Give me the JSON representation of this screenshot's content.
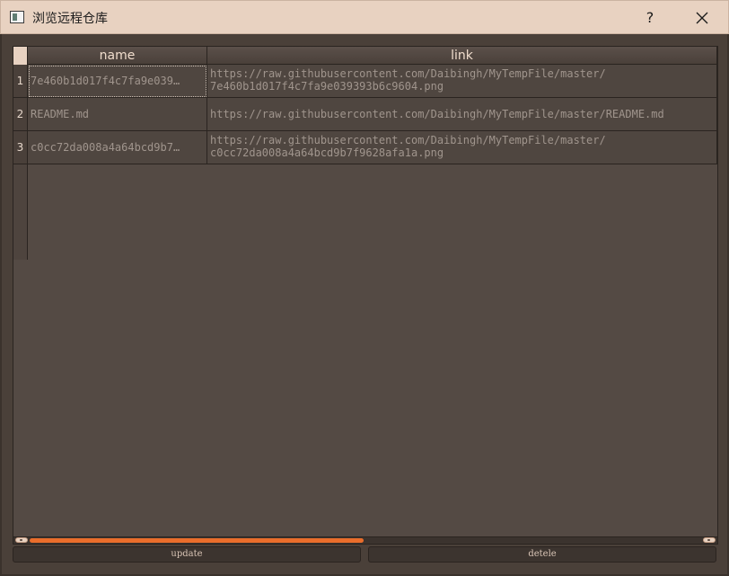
{
  "window": {
    "title": "浏览远程仓库",
    "help_label": "?"
  },
  "table": {
    "headers": [
      "name",
      "link"
    ],
    "rows": [
      {
        "index": "1",
        "name": "7e460b1d017f4c7fa9e039…",
        "link_lines": [
          "https://raw.githubusercontent.com/Daibingh/MyTempFile/master/",
          "7e460b1d017f4c7fa9e039393b6c9604.png"
        ]
      },
      {
        "index": "2",
        "name": "README.md",
        "link_lines": [
          "https://raw.githubusercontent.com/Daibingh/MyTempFile/master/README.md"
        ]
      },
      {
        "index": "3",
        "name": "c0cc72da008a4a64bcd9b7…",
        "link_lines": [
          "https://raw.githubusercontent.com/Daibingh/MyTempFile/master/",
          "c0cc72da008a4a64bcd9b7f9628afa1a.png"
        ]
      }
    ]
  },
  "horizontal_scroll_position": 0,
  "buttons": {
    "update": "update",
    "delete": "detele"
  },
  "colors": {
    "titlebar": "#e8d2c1",
    "accent": "#ea6d2b",
    "background": "#4a4039"
  }
}
